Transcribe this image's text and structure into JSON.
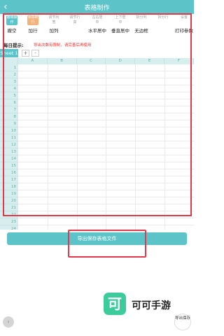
{
  "app": {
    "title": "表格制作",
    "back_glyph": "‹"
  },
  "toolbar": {
    "items": [
      {
        "icon": "undo-icon",
        "icon_text": "撤销操作",
        "label": "撤空",
        "style": "teal"
      },
      {
        "icon": "add-row-icon",
        "icon_text": "添加新行",
        "label": "加行",
        "style": "orange"
      },
      {
        "icon": "col-width-icon",
        "icon_text": "调节列宽",
        "label": "加列",
        "style": "plain"
      },
      {
        "icon": "row-height-icon",
        "icon_text": "调节行高",
        "label": "",
        "style": "plain"
      },
      {
        "icon": "align-center-icon",
        "icon_text": "左右居中",
        "label": "水平居中",
        "style": "plain"
      },
      {
        "icon": "valign-center-icon",
        "icon_text": "上下居中",
        "label": "垂直居中",
        "style": "plain"
      },
      {
        "icon": "split-col-icon",
        "icon_text": "拆分列",
        "label": "无边框",
        "style": "plain"
      },
      {
        "icon": "split-row-icon",
        "icon_text": "拆分行",
        "label": "",
        "style": "plain"
      },
      {
        "icon": "print-settings-icon",
        "icon_text": "设置",
        "label": "打印参数",
        "style": "plain"
      }
    ]
  },
  "notice": {
    "label": "每日提示:",
    "text": "导出次数有限制，请完善后再使用"
  },
  "sheets": {
    "tabs": [
      "Sheet 1"
    ],
    "add_glyph": "+",
    "more_glyph": "-"
  },
  "grid": {
    "columns": [
      "A",
      "B",
      "C",
      "D",
      "E",
      "F"
    ],
    "rows": [
      "1",
      "2",
      "3",
      "4",
      "5",
      "6",
      "7",
      "8",
      "9",
      "10",
      "11",
      "12",
      "13",
      "14",
      "15",
      "16",
      "17",
      "18",
      "19",
      "20",
      "21",
      "22",
      "23",
      "24"
    ]
  },
  "export_button": {
    "label": "导出保存表格文件"
  },
  "watermark": {
    "logo_char": "可",
    "text": "可可手游"
  },
  "fab_left": {
    "glyph": "‹"
  },
  "fab_right": {
    "label": "导出保存"
  },
  "colors": {
    "accent": "#5cc4c9",
    "highlight_box": "#e2384b",
    "orange_icon": "#f2b37b",
    "notice": "#e33333"
  }
}
